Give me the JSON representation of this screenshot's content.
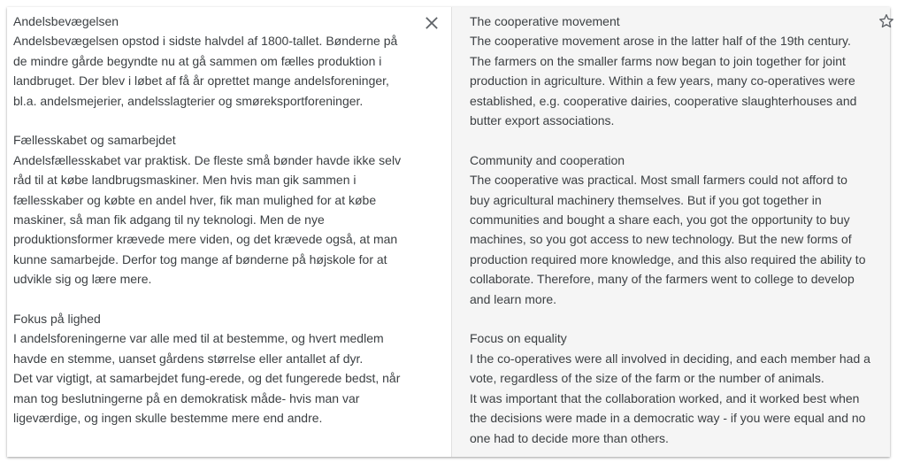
{
  "source": {
    "title1": "Andelsbevægelsen",
    "text1": "Andelsbevægelsen opstod i sidste halvdel af 1800-tallet. Bønderne på de mindre gårde begyndte nu at gå sammen om fælles produktion i landbruget. Der blev i løbet af få år oprettet mange andelsforeninger, bl.a. andelsmejerier, andelsslagterier og smøreksportforeninger.",
    "title2": "Fællesskabet og samarbejdet",
    "text2": "Andelsfællesskabet var praktisk. De fleste små bønder havde ikke selv råd til at købe landbrugsmaskiner. Men hvis man gik sammen i fællesskaber og købte en andel hver, fik man mulighed for at købe maskiner, så man fik adgang til ny teknologi. Men de nye produktionsformer krævede mere viden, og det krævede også, at man kunne samarbejde. Derfor tog mange af bønderne på højskole for at udvikle sig og lære mere.",
    "title3": "Fokus på lighed",
    "text3a": "I andelsforeningerne var alle med til at bestemme, og hvert medlem havde en stemme, uanset gårdens størrelse eller antallet af dyr.",
    "text3b": "Det var vigtigt, at samarbejdet fung-erede, og det fungerede bedst, når man tog beslutningerne på en demokratisk måde- hvis man var ligeværdige, og ingen skulle bestemme mere end andre."
  },
  "target": {
    "title1": "The cooperative movement",
    "text1": "The cooperative movement arose in the latter half of the 19th century. The farmers on the smaller farms now began to join together for joint production in agriculture. Within a few years, many co-operatives were established, e.g. cooperative dairies, cooperative slaughterhouses and butter export associations.",
    "title2": "Community and cooperation",
    "text2": "The cooperative was practical. Most small farmers could not afford to buy agricultural machinery themselves. But if you got together in communities and bought a share each, you got the opportunity to buy machines, so you got access to new technology. But the new forms of production required more knowledge, and this also required the ability to collaborate. Therefore, many of the farmers went to college to develop and learn more.",
    "title3": "Focus on equality",
    "text3a": "I the co-operatives were all involved in deciding, and each member had a vote, regardless of the size of the farm or the number of animals.",
    "text3b": "It was important that the collaboration worked, and it worked best when the decisions were made in a democratic way - if you were equal and no one had to decide more than others."
  },
  "icons": {
    "close": "close-icon",
    "star": "star-outline-icon"
  },
  "colors": {
    "text": "#3c4043",
    "target_background": "#f5f5f5",
    "icon": "#5f6368"
  }
}
